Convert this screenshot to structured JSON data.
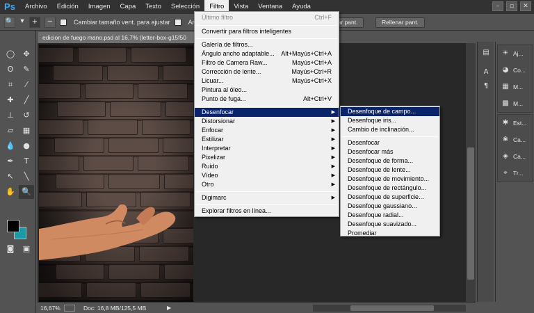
{
  "app": {
    "logo": "Ps"
  },
  "menubar": {
    "items": [
      "Archivo",
      "Edición",
      "Imagen",
      "Capa",
      "Texto",
      "Selección",
      "Filtro",
      "Vista",
      "Ventana",
      "Ayuda"
    ],
    "active": "Filtro"
  },
  "window_controls": {
    "minimize": "–",
    "restore": "▫",
    "close": "✕"
  },
  "options": {
    "zoom_icon": "magnifier-icon",
    "resize_windows_label": "Cambiar tamaño vent. para ajustar",
    "amplify_label": "Ampli",
    "fit_screen_button": "star pant.",
    "fill_screen_button": "Rellenar pant."
  },
  "document": {
    "tab_title": "edicion de fuego mano.psd al 16,7% (letter-box-g15f50",
    "zoom": "16,67%",
    "doc_info": "Doc: 16,8 MB/125,5 MB"
  },
  "filter_menu": {
    "items": [
      {
        "label": "Último filtro",
        "shortcut": "Ctrl+F",
        "disabled": true
      },
      {
        "sep": true
      },
      {
        "label": "Convertir para filtros inteligentes"
      },
      {
        "sep": true
      },
      {
        "label": "Galería de filtros..."
      },
      {
        "label": "Ángulo ancho adaptable...",
        "shortcut": "Alt+Mayús+Ctrl+A"
      },
      {
        "label": "Filtro de Camera Raw...",
        "shortcut": "Mayús+Ctrl+A"
      },
      {
        "label": "Corrección de lente...",
        "shortcut": "Mayús+Ctrl+R"
      },
      {
        "label": "Licuar...",
        "shortcut": "Mayús+Ctrl+X"
      },
      {
        "label": "Pintura al óleo..."
      },
      {
        "label": "Punto de fuga...",
        "shortcut": "Alt+Ctrl+V"
      },
      {
        "sep": true
      },
      {
        "label": "Desenfocar",
        "submenu": true,
        "highlight": true
      },
      {
        "label": "Distorsionar",
        "submenu": true
      },
      {
        "label": "Enfocar",
        "submenu": true
      },
      {
        "label": "Estilizar",
        "submenu": true
      },
      {
        "label": "Interpretar",
        "submenu": true
      },
      {
        "label": "Pixelizar",
        "submenu": true
      },
      {
        "label": "Ruido",
        "submenu": true
      },
      {
        "label": "Vídeo",
        "submenu": true
      },
      {
        "label": "Otro",
        "submenu": true
      },
      {
        "sep": true
      },
      {
        "label": "Digimarc",
        "submenu": true
      },
      {
        "sep": true
      },
      {
        "label": "Explorar filtros en línea..."
      }
    ]
  },
  "blur_submenu": {
    "items": [
      {
        "label": "Desenfoque de campo...",
        "highlight": true
      },
      {
        "label": "Desenfoque iris..."
      },
      {
        "label": "Cambio de inclinación..."
      },
      {
        "sep": true
      },
      {
        "label": "Desenfocar"
      },
      {
        "label": "Desenfocar más"
      },
      {
        "label": "Desenfoque de forma..."
      },
      {
        "label": "Desenfoque de lente..."
      },
      {
        "label": "Desenfoque de movimiento..."
      },
      {
        "label": "Desenfoque de rectángulo..."
      },
      {
        "label": "Desenfoque de superficie..."
      },
      {
        "label": "Desenfoque gaussiano..."
      },
      {
        "label": "Desenfoque radial..."
      },
      {
        "label": "Desenfoque suavizado..."
      },
      {
        "label": "Promediar"
      }
    ]
  },
  "panels": {
    "group1": [
      {
        "icon": "adjustments-icon",
        "label": "Aj..."
      },
      {
        "icon": "color-icon",
        "label": "Co..."
      },
      {
        "icon": "masks-icon",
        "label": "M..."
      },
      {
        "icon": "swatches-icon",
        "label": "M..."
      }
    ],
    "group2": [
      {
        "icon": "styles-icon",
        "label": "Est..."
      },
      {
        "icon": "channels-icon",
        "label": "Ca..."
      },
      {
        "icon": "layers-icon",
        "label": "Ca..."
      },
      {
        "icon": "paths-icon",
        "label": "Tr..."
      }
    ]
  },
  "colors": {
    "foreground": "#000000",
    "background": "#1a9aa8",
    "menu_highlight": "#0a246a"
  }
}
